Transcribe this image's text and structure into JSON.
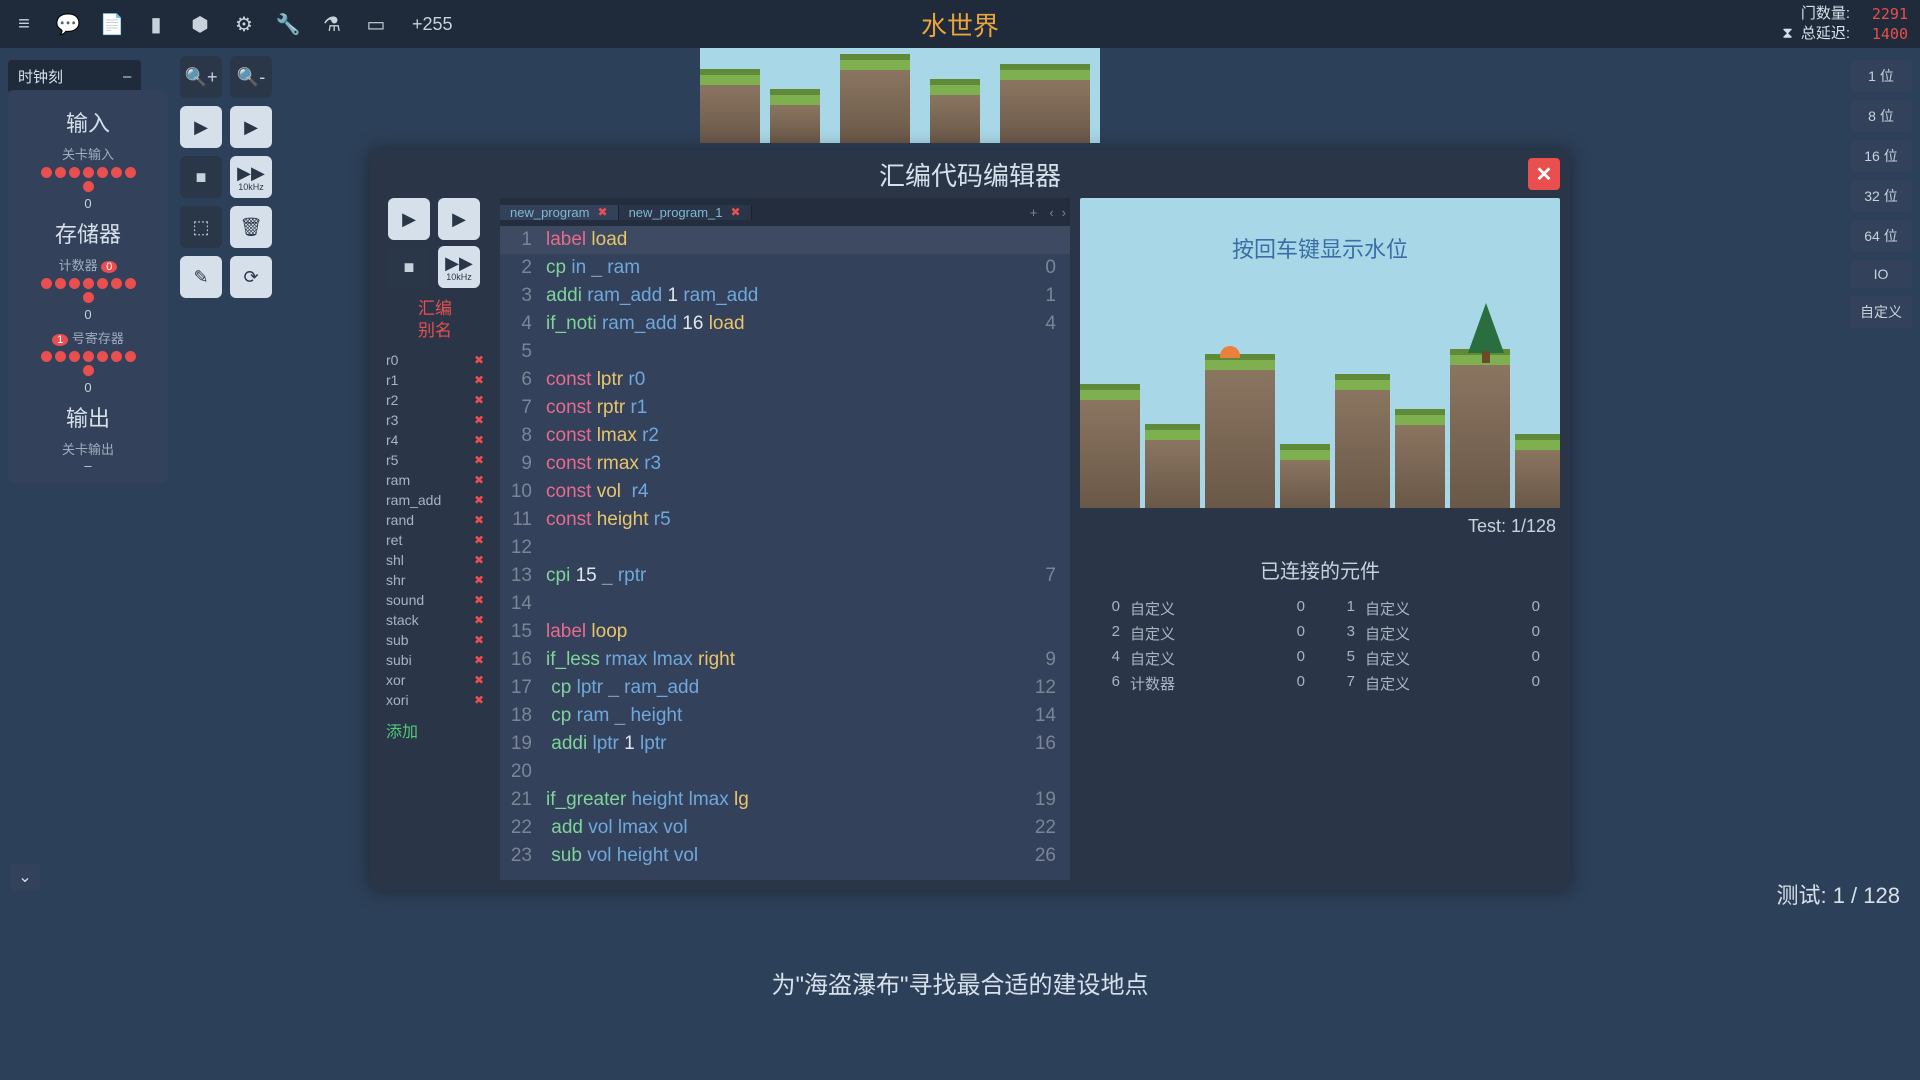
{
  "topbar": {
    "title": "水世界",
    "plus_count": "+255",
    "stats": {
      "gates_label": "门数量:",
      "gates_value": "2291",
      "delay_label": "总延迟:",
      "delay_value": "1400"
    }
  },
  "clock": {
    "label": "时钟刻",
    "collapse": "–"
  },
  "left_panel": {
    "input_title": "输入",
    "input_sub": "关卡输入",
    "input_val": "0",
    "storage_title": "存储器",
    "counter_sub": "计数器",
    "counter_badge": "0",
    "counter_val": "0",
    "reg_sub": "号寄存器",
    "reg_badge": "1",
    "reg_val": "0",
    "output_title": "输出",
    "output_sub": "关卡输出",
    "output_val": "–"
  },
  "controls": {
    "tenk": "10kHz"
  },
  "modal": {
    "title": "汇编代码编辑器",
    "tabs": [
      {
        "name": "new_program",
        "active": true
      },
      {
        "name": "new_program_1",
        "active": false
      }
    ],
    "asm_header": "汇编\n别名",
    "aliases": [
      "r0",
      "r1",
      "r2",
      "r3",
      "r4",
      "r5",
      "ram",
      "ram_add",
      "rand",
      "ret",
      "shl",
      "shr",
      "sound",
      "stack",
      "sub",
      "subi",
      "xor",
      "xori"
    ],
    "add_label": "添加",
    "code_lines": [
      {
        "n": 1,
        "hl": true,
        "tokens": [
          [
            "kw-red",
            "label "
          ],
          [
            "kw-yel",
            "load"
          ]
        ],
        "val": ""
      },
      {
        "n": 2,
        "tokens": [
          [
            "kw-grn",
            "cp "
          ],
          [
            "kw-blu",
            "in "
          ],
          [
            "kw-dim",
            "_ "
          ],
          [
            "kw-blu",
            "ram"
          ]
        ],
        "val": "0"
      },
      {
        "n": 3,
        "tokens": [
          [
            "kw-grn",
            "addi "
          ],
          [
            "kw-blu",
            "ram_add "
          ],
          [
            "kw-wht",
            "1 "
          ],
          [
            "kw-blu",
            "ram_add"
          ]
        ],
        "val": "1"
      },
      {
        "n": 4,
        "tokens": [
          [
            "kw-grn",
            "if_noti "
          ],
          [
            "kw-blu",
            "ram_add "
          ],
          [
            "kw-wht",
            "16 "
          ],
          [
            "kw-yel",
            "load"
          ]
        ],
        "val": "4"
      },
      {
        "n": 5,
        "tokens": [],
        "val": ""
      },
      {
        "n": 6,
        "tokens": [
          [
            "kw-red",
            "const "
          ],
          [
            "kw-yel",
            "lptr "
          ],
          [
            "kw-blu",
            "r0"
          ]
        ],
        "val": ""
      },
      {
        "n": 7,
        "tokens": [
          [
            "kw-red",
            "const "
          ],
          [
            "kw-yel",
            "rptr "
          ],
          [
            "kw-blu",
            "r1"
          ]
        ],
        "val": ""
      },
      {
        "n": 8,
        "tokens": [
          [
            "kw-red",
            "const "
          ],
          [
            "kw-yel",
            "lmax "
          ],
          [
            "kw-blu",
            "r2"
          ]
        ],
        "val": ""
      },
      {
        "n": 9,
        "tokens": [
          [
            "kw-red",
            "const "
          ],
          [
            "kw-yel",
            "rmax "
          ],
          [
            "kw-blu",
            "r3"
          ]
        ],
        "val": ""
      },
      {
        "n": 10,
        "tokens": [
          [
            "kw-red",
            "const "
          ],
          [
            "kw-yel",
            "vol  "
          ],
          [
            "kw-blu",
            "r4"
          ]
        ],
        "val": ""
      },
      {
        "n": 11,
        "tokens": [
          [
            "kw-red",
            "const "
          ],
          [
            "kw-yel",
            "height "
          ],
          [
            "kw-blu",
            "r5"
          ]
        ],
        "val": ""
      },
      {
        "n": 12,
        "tokens": [],
        "val": ""
      },
      {
        "n": 13,
        "tokens": [
          [
            "kw-grn",
            "cpi "
          ],
          [
            "kw-wht",
            "15 "
          ],
          [
            "kw-dim",
            "_ "
          ],
          [
            "kw-blu",
            "rptr"
          ]
        ],
        "val": "7"
      },
      {
        "n": 14,
        "tokens": [],
        "val": ""
      },
      {
        "n": 15,
        "tokens": [
          [
            "kw-red",
            "label "
          ],
          [
            "kw-yel",
            "loop"
          ]
        ],
        "val": ""
      },
      {
        "n": 16,
        "tokens": [
          [
            "kw-grn",
            "if_less "
          ],
          [
            "kw-blu",
            "rmax "
          ],
          [
            "kw-blu",
            "lmax "
          ],
          [
            "kw-yel",
            "right"
          ]
        ],
        "val": "9"
      },
      {
        "n": 17,
        "tokens": [
          [
            "kw-grn",
            " cp "
          ],
          [
            "kw-blu",
            "lptr "
          ],
          [
            "kw-dim",
            "_ "
          ],
          [
            "kw-blu",
            "ram_add"
          ]
        ],
        "val": "12"
      },
      {
        "n": 18,
        "tokens": [
          [
            "kw-grn",
            " cp "
          ],
          [
            "kw-blu",
            "ram "
          ],
          [
            "kw-dim",
            "_ "
          ],
          [
            "kw-blu",
            "height"
          ]
        ],
        "val": "14"
      },
      {
        "n": 19,
        "tokens": [
          [
            "kw-grn",
            " addi "
          ],
          [
            "kw-blu",
            "lptr "
          ],
          [
            "kw-wht",
            "1 "
          ],
          [
            "kw-blu",
            "lptr"
          ]
        ],
        "val": "16"
      },
      {
        "n": 20,
        "tokens": [],
        "val": ""
      },
      {
        "n": 21,
        "tokens": [
          [
            "kw-grn",
            "if_greater "
          ],
          [
            "kw-blu",
            "height "
          ],
          [
            "kw-blu",
            "lmax "
          ],
          [
            "kw-yel",
            "lg"
          ]
        ],
        "val": "19"
      },
      {
        "n": 22,
        "tokens": [
          [
            "kw-grn",
            " add "
          ],
          [
            "kw-blu",
            "vol "
          ],
          [
            "kw-blu",
            "lmax "
          ],
          [
            "kw-blu",
            "vol"
          ]
        ],
        "val": "22"
      },
      {
        "n": 23,
        "tokens": [
          [
            "kw-grn",
            " sub "
          ],
          [
            "kw-blu",
            "vol "
          ],
          [
            "kw-blu",
            "height "
          ],
          [
            "kw-blu",
            "vol"
          ]
        ],
        "val": "26"
      }
    ],
    "preview_prompt": "按回车键显示水位",
    "test_label": "Test: 1/128",
    "connected_title": "已连接的元件",
    "connected": [
      {
        "idx": "0",
        "name": "自定义",
        "val": "0"
      },
      {
        "idx": "1",
        "name": "自定义",
        "val": "0"
      },
      {
        "idx": "2",
        "name": "自定义",
        "val": "0"
      },
      {
        "idx": "3",
        "name": "自定义",
        "val": "0"
      },
      {
        "idx": "4",
        "name": "自定义",
        "val": "0"
      },
      {
        "idx": "5",
        "name": "自定义",
        "val": "0"
      },
      {
        "idx": "6",
        "name": "计数器",
        "val": "0"
      },
      {
        "idx": "7",
        "name": "自定义",
        "val": "0"
      }
    ]
  },
  "bits": [
    "1 位",
    "8 位",
    "16 位",
    "32 位",
    "64 位",
    "IO",
    "自定义"
  ],
  "bottom_test": "测试:  1 / 128",
  "hint": "为\"海盗瀑布\"寻找最合适的建设地点"
}
